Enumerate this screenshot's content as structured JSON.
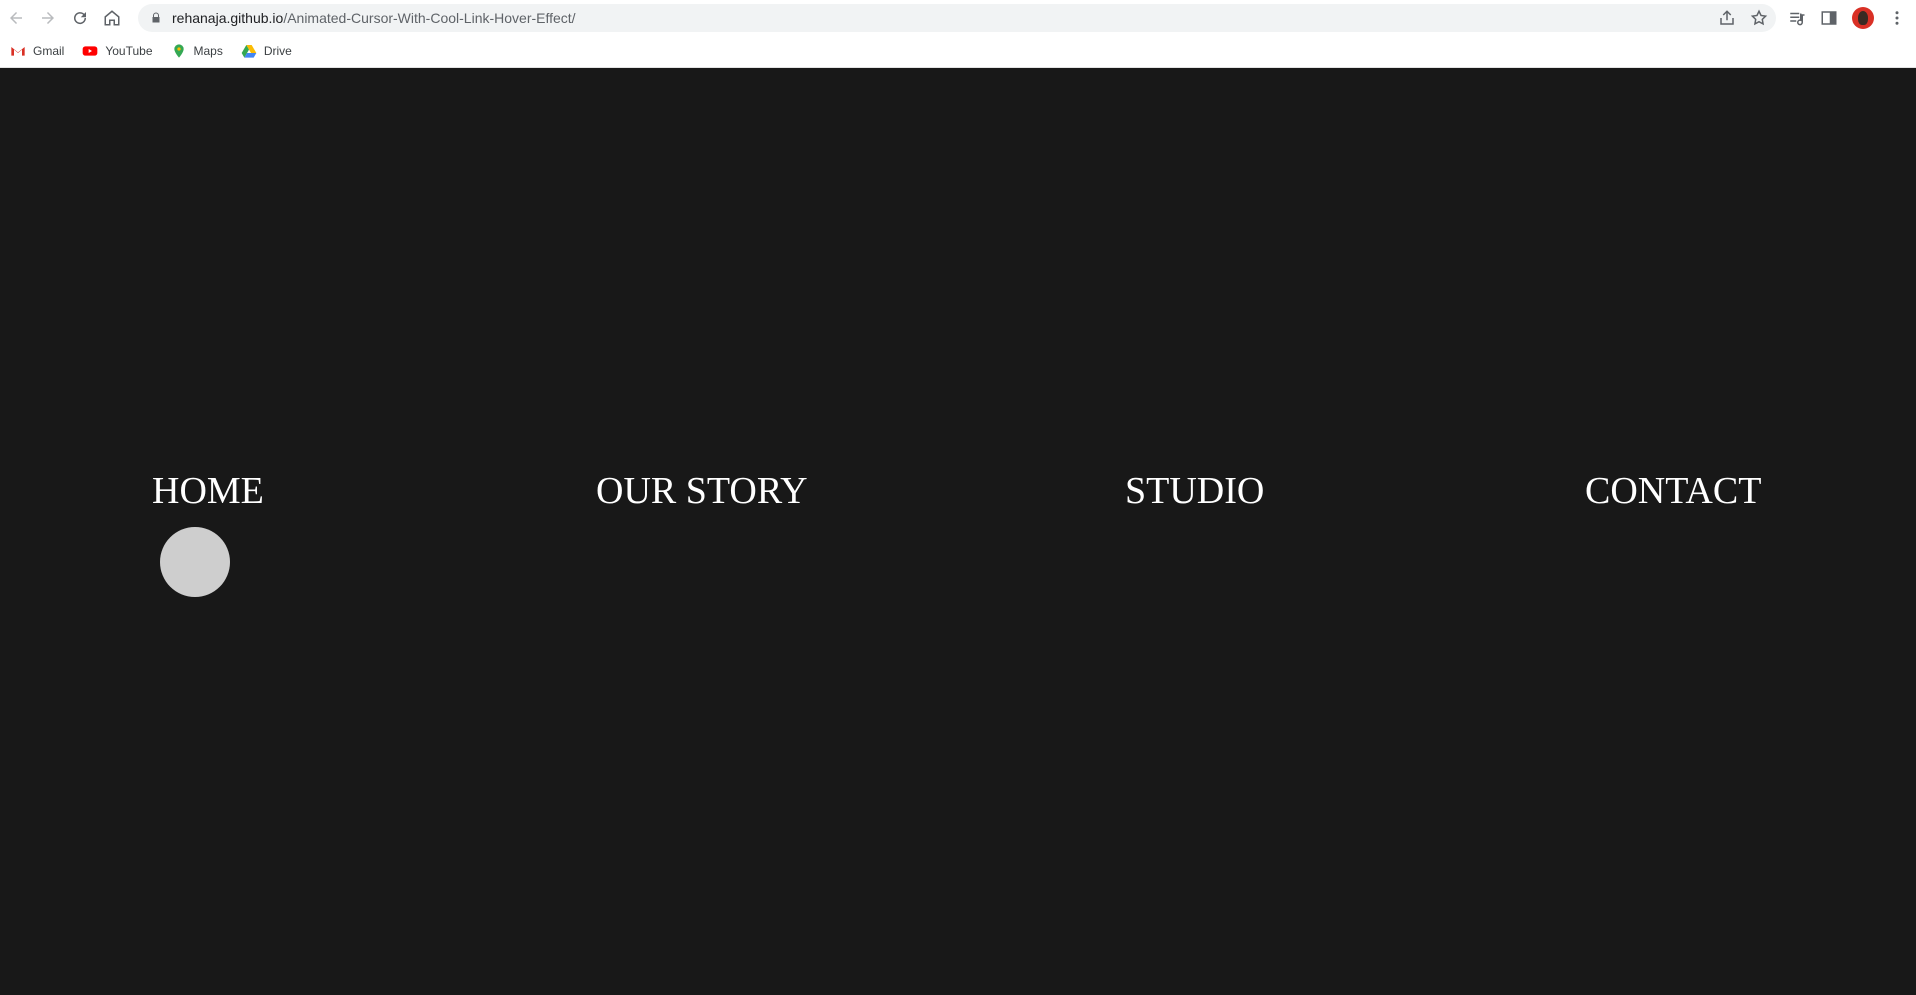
{
  "browser": {
    "url_host": "rehanaja.github.io",
    "url_path": "/Animated-Cursor-With-Cool-Link-Hover-Effect/",
    "icons": [
      "back-icon",
      "forward-icon",
      "reload-icon",
      "home-icon",
      "lock-icon",
      "share-icon",
      "star-icon",
      "media-icon",
      "side-panel-icon",
      "profile-avatar",
      "menu-icon"
    ]
  },
  "bookmarks": [
    {
      "label": "Gmail",
      "icon": "gmail-icon"
    },
    {
      "label": "YouTube",
      "icon": "youtube-icon"
    },
    {
      "label": "Maps",
      "icon": "maps-icon"
    },
    {
      "label": "Drive",
      "icon": "drive-icon"
    }
  ],
  "nav": {
    "home": "HOME",
    "our_story": "OUR STORY",
    "studio": "STUDIO",
    "contact": "CONTACT"
  },
  "colors": {
    "background": "#181818",
    "text": "#ffffff",
    "cursor": "#e6e6e6"
  }
}
